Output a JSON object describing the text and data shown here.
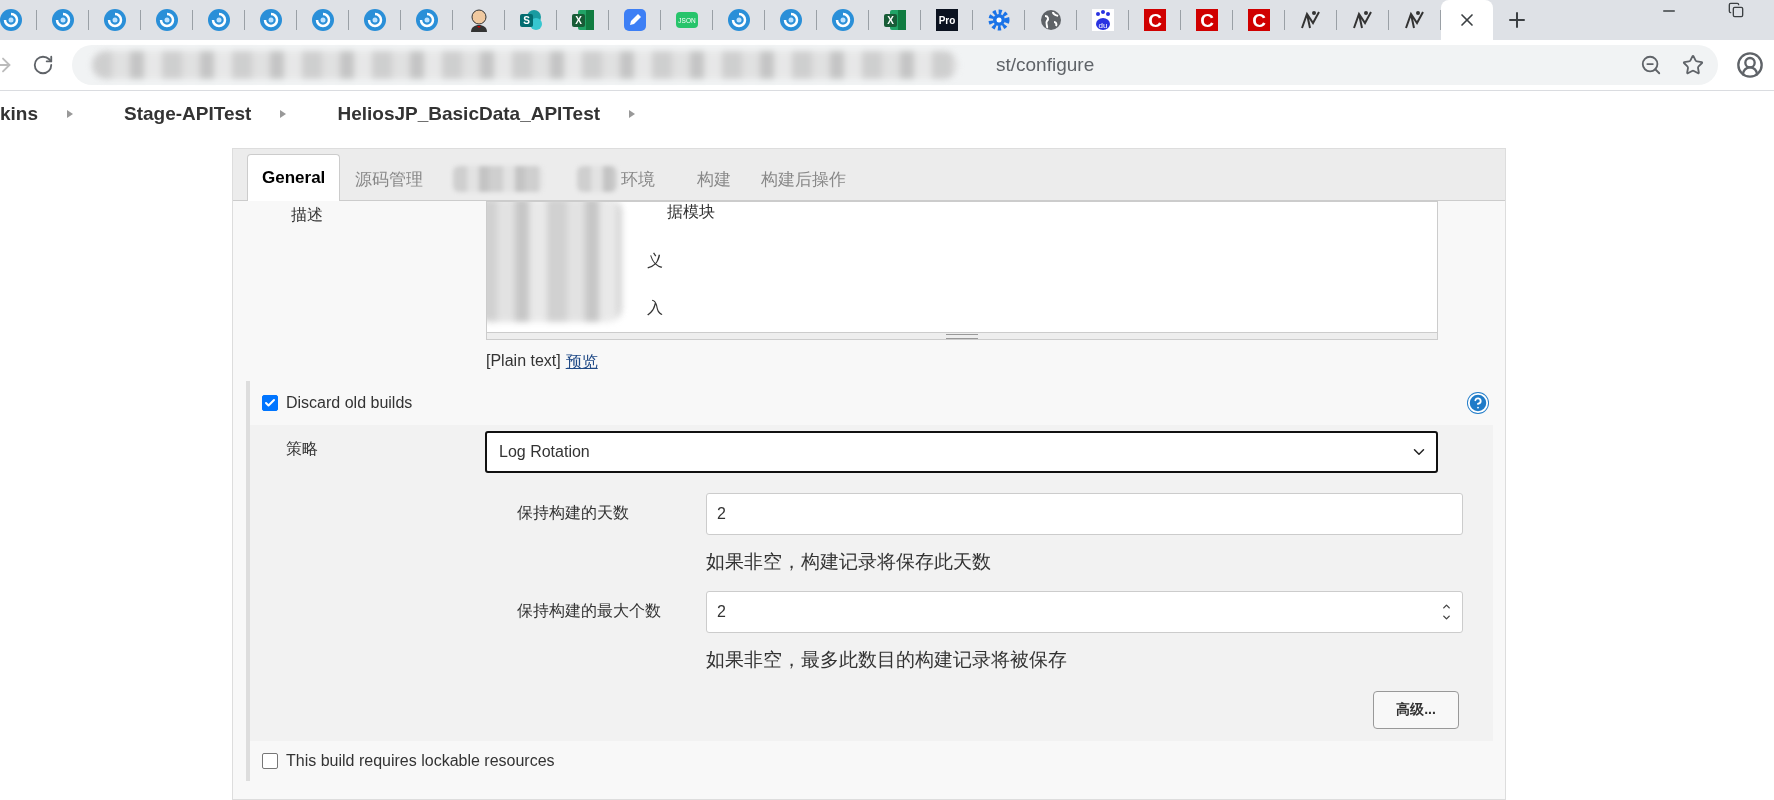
{
  "browser": {
    "tabs": [
      {
        "kind": "swirl",
        "selected": false
      },
      {
        "kind": "swirl",
        "selected": false
      },
      {
        "kind": "swirl",
        "selected": false
      },
      {
        "kind": "swirl",
        "selected": false
      },
      {
        "kind": "swirl",
        "selected": false
      },
      {
        "kind": "swirl",
        "selected": false
      },
      {
        "kind": "swirl",
        "selected": false
      },
      {
        "kind": "swirl",
        "selected": false
      },
      {
        "kind": "swirl",
        "selected": false
      },
      {
        "kind": "butler",
        "selected": false
      },
      {
        "kind": "sheet",
        "label": "S",
        "selected": false
      },
      {
        "kind": "excel",
        "label": "X",
        "selected": false
      },
      {
        "kind": "pen",
        "selected": false
      },
      {
        "kind": "json",
        "label": "JSON",
        "selected": false
      },
      {
        "kind": "swirl",
        "selected": false
      },
      {
        "kind": "swirl",
        "selected": false
      },
      {
        "kind": "swirl",
        "selected": false
      },
      {
        "kind": "excel",
        "label": "X",
        "selected": false
      },
      {
        "kind": "pro",
        "label": "Pro",
        "selected": false
      },
      {
        "kind": "gear",
        "selected": false
      },
      {
        "kind": "globe",
        "selected": false
      },
      {
        "kind": "paw",
        "label": "du",
        "selected": false
      },
      {
        "kind": "letter",
        "label": "C",
        "selected": false
      },
      {
        "kind": "letter",
        "label": "C",
        "selected": false
      },
      {
        "kind": "letter",
        "label": "C",
        "selected": false
      },
      {
        "kind": "figure",
        "selected": false
      },
      {
        "kind": "figure",
        "selected": false
      },
      {
        "kind": "figure",
        "selected": false
      },
      {
        "selected": true
      }
    ],
    "address": {
      "url": "st/configure"
    },
    "breadcrumb": [
      "kins",
      "Stage-APITest",
      "HeliosJP_BasicData_APITest"
    ]
  },
  "config": {
    "tabs": [
      {
        "label": "General",
        "selected": true,
        "blurred": false
      },
      {
        "label": "源码管理",
        "selected": false,
        "blurred": false
      },
      {
        "selected": false,
        "blurred": true
      },
      {
        "label": "环境",
        "selected": false,
        "blurred": true
      },
      {
        "label": "构建",
        "selected": false,
        "blurred": false
      },
      {
        "label": "构建后操作",
        "selected": false,
        "blurred": false
      }
    ],
    "description": {
      "label": "描述",
      "lines": [
        "据模块",
        "义",
        "入"
      ],
      "format": "[Plain text]",
      "preview_link": "预览"
    },
    "discard": {
      "label": "Discard old builds",
      "checked": true,
      "strategy": {
        "label": "策略",
        "value": "Log Rotation"
      },
      "fields": [
        {
          "label": "保持构建的天数",
          "value": "2",
          "kind": "text",
          "hint": "如果非空，构建记录将保存此天数"
        },
        {
          "label": "保持构建的最大个数",
          "value": "2",
          "kind": "number",
          "hint": "如果非空，最多此数目的构建记录将被保存"
        }
      ],
      "advanced_button": "高级..."
    },
    "lockable": {
      "label": "This build requires lockable resources",
      "checked": false
    }
  }
}
